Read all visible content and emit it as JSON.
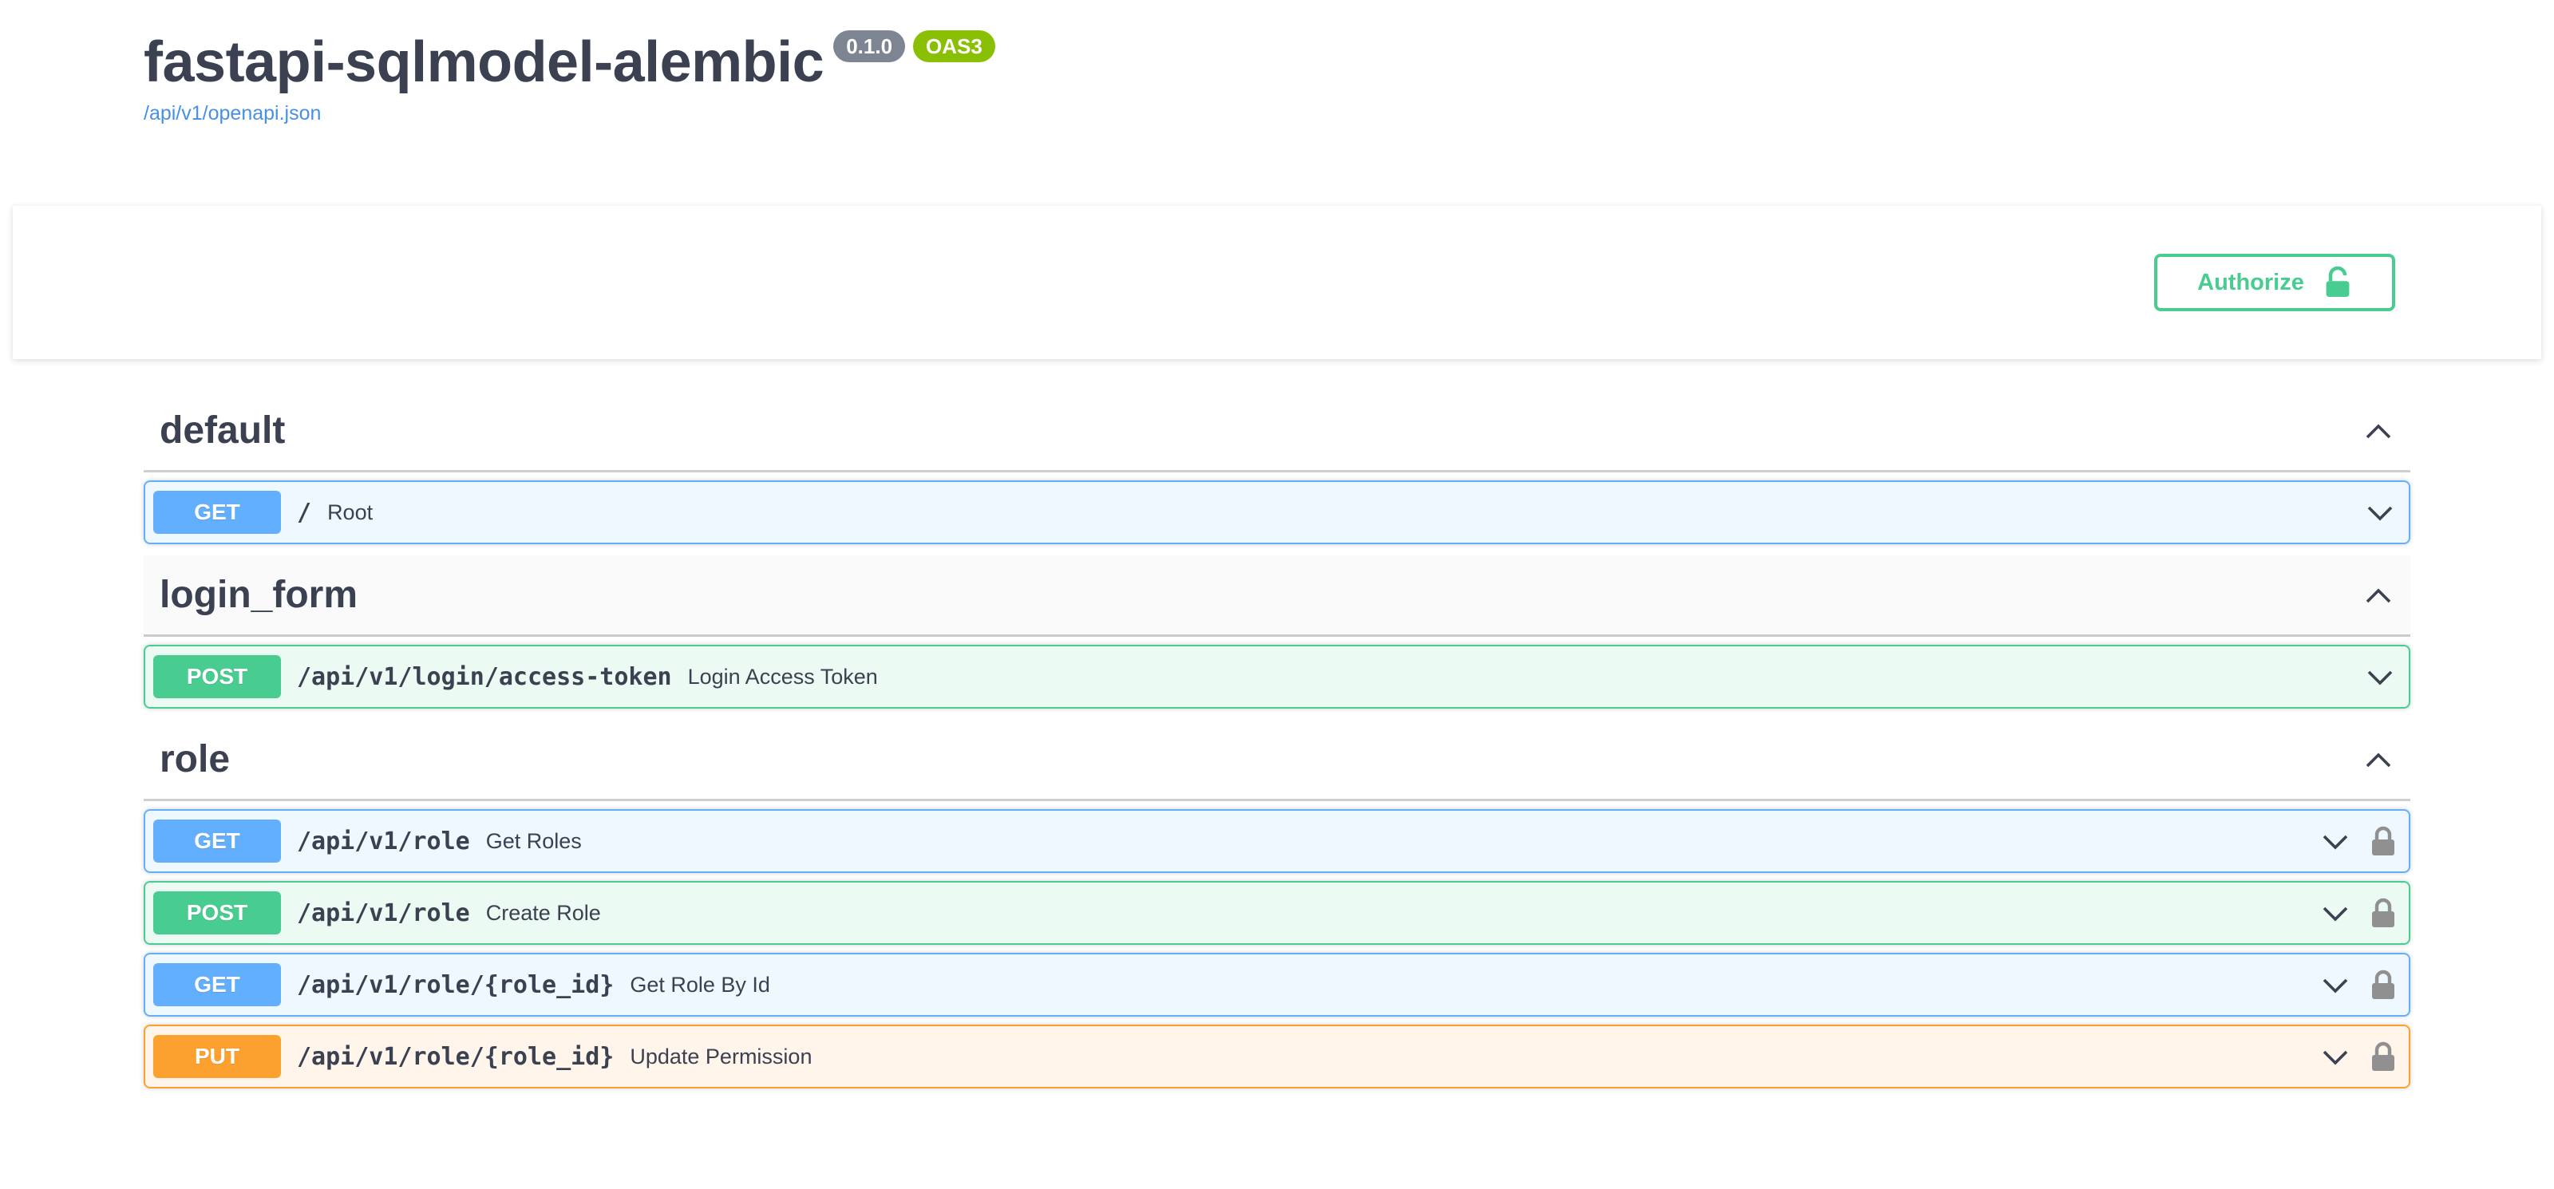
{
  "info": {
    "title": "fastapi-sqlmodel-alembic",
    "version": "0.1.0",
    "oas_badge": "OAS3",
    "spec_link": "/api/v1/openapi.json"
  },
  "authorize": {
    "label": "Authorize",
    "icon": "unlocked-icon"
  },
  "colors": {
    "get": "#61affe",
    "post": "#49cc90",
    "put": "#fca130",
    "text": "#3b4151",
    "link": "#4990e2"
  },
  "tags": [
    {
      "name": "default",
      "operations": [
        {
          "method": "GET",
          "path": "/",
          "summary": "Root",
          "locked": false
        }
      ]
    },
    {
      "name": "login_form",
      "operations": [
        {
          "method": "POST",
          "path": "/api/v1/login/access-token",
          "summary": "Login Access Token",
          "locked": false
        }
      ]
    },
    {
      "name": "role",
      "operations": [
        {
          "method": "GET",
          "path": "/api/v1/role",
          "summary": "Get Roles",
          "locked": true
        },
        {
          "method": "POST",
          "path": "/api/v1/role",
          "summary": "Create Role",
          "locked": true
        },
        {
          "method": "GET",
          "path": "/api/v1/role/{role_id}",
          "summary": "Get Role By Id",
          "locked": true
        },
        {
          "method": "PUT",
          "path": "/api/v1/role/{role_id}",
          "summary": "Update Permission",
          "locked": true
        }
      ]
    }
  ]
}
